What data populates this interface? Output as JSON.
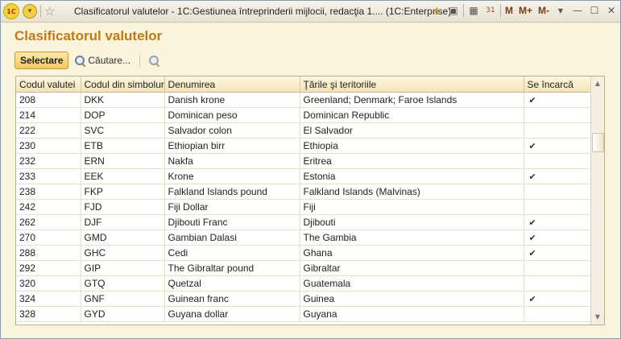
{
  "window": {
    "title": "Clasificatorul valutelor - 1C:Gestiunea întreprinderii mijlocii, redacţia 1....  (1C:Enterprise)",
    "logo_text": "1С",
    "right_icons": [
      "favorite-add-icon",
      "bookmark-icon",
      "calculator-icon",
      "calendar-icon"
    ],
    "memory_labels": [
      "M",
      "M+",
      "M-"
    ]
  },
  "page": {
    "heading": "Clasificatorul valutelor"
  },
  "toolbar": {
    "select_label": "Selectare",
    "search_label": "Căutare..."
  },
  "table": {
    "columns": [
      "Codul valutei",
      "Codul din simboluri",
      "Denumirea",
      "Ţările şi teritoriile",
      "Se încarcă"
    ],
    "rows": [
      {
        "code": "208",
        "symbol": "DKK",
        "name": "Danish krone",
        "countries": "Greenland; Denmark; Faroe Islands",
        "loaded": "✔"
      },
      {
        "code": "214",
        "symbol": "DOP",
        "name": "Dominican peso",
        "countries": "Dominican Republic",
        "loaded": ""
      },
      {
        "code": "222",
        "symbol": "SVC",
        "name": "Salvador colon",
        "countries": "El Salvador",
        "loaded": ""
      },
      {
        "code": "230",
        "symbol": "ETB",
        "name": "Ethiopian birr",
        "countries": "Ethiopia",
        "loaded": "✔"
      },
      {
        "code": "232",
        "symbol": "ERN",
        "name": "Nakfa",
        "countries": "Eritrea",
        "loaded": ""
      },
      {
        "code": "233",
        "symbol": "EEK",
        "name": "Krone",
        "countries": "Estonia",
        "loaded": "✔"
      },
      {
        "code": "238",
        "symbol": "FKP",
        "name": "Falkland Islands pound",
        "countries": "Falkland Islands (Malvinas)",
        "loaded": ""
      },
      {
        "code": "242",
        "symbol": "FJD",
        "name": "Fiji Dollar",
        "countries": "Fiji",
        "loaded": ""
      },
      {
        "code": "262",
        "symbol": "DJF",
        "name": "Djibouti Franc",
        "countries": "Djibouti",
        "loaded": "✔"
      },
      {
        "code": "270",
        "symbol": "GMD",
        "name": "Gambian Dalasi",
        "countries": "The Gambia",
        "loaded": "✔"
      },
      {
        "code": "288",
        "symbol": "GHC",
        "name": "Cedi",
        "countries": "Ghana",
        "loaded": "✔"
      },
      {
        "code": "292",
        "symbol": "GIP",
        "name": "The Gibraltar pound",
        "countries": "Gibraltar",
        "loaded": ""
      },
      {
        "code": "320",
        "symbol": "GTQ",
        "name": "Quetzal",
        "countries": "Guatemala",
        "loaded": ""
      },
      {
        "code": "324",
        "symbol": "GNF",
        "name": "Guinean franc",
        "countries": "Guinea",
        "loaded": "✔"
      },
      {
        "code": "328",
        "symbol": "GYD",
        "name": "Guyana dollar",
        "countries": "Guyana",
        "loaded": ""
      }
    ]
  }
}
